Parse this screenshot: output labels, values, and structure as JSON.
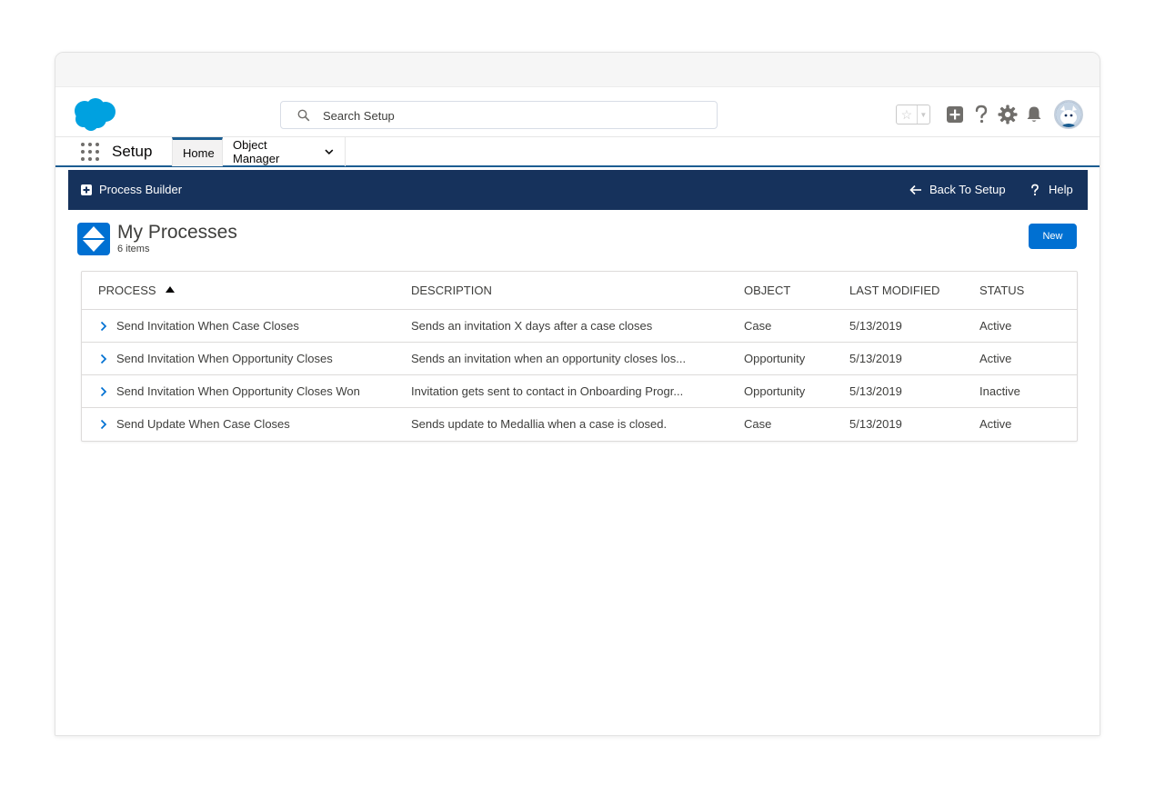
{
  "header": {
    "search_placeholder": "Search Setup"
  },
  "nav": {
    "app_name": "Setup",
    "tabs": [
      {
        "label": "Home",
        "active": true
      },
      {
        "label": "Object Manager",
        "active": false
      }
    ]
  },
  "process_builder_bar": {
    "title": "Process Builder",
    "back_label": "Back To Setup",
    "help_label": "Help",
    "background": "#16325c"
  },
  "page": {
    "title": "My Processes",
    "count": "6 items",
    "new_button": "New",
    "accent": "#0070d2"
  },
  "table": {
    "columns": [
      "PROCESS",
      "DESCRIPTION",
      "OBJECT",
      "LAST MODIFIED",
      "STATUS"
    ],
    "sort_column": "PROCESS",
    "sort_direction": "ascending",
    "rows": [
      {
        "process": "Send Invitation When Case Closes",
        "description": "Sends an invitation X days after a case closes",
        "object": "Case",
        "last_modified": "5/13/2019",
        "status": "Active"
      },
      {
        "process": "Send Invitation When Opportunity Closes",
        "description": "Sends an invitation when an opportunity closes los...",
        "object": "Opportunity",
        "last_modified": "5/13/2019",
        "status": "Active"
      },
      {
        "process": "Send Invitation When Opportunity Closes Won",
        "description": "Invitation gets sent to contact in Onboarding Progr...",
        "object": "Opportunity",
        "last_modified": "5/13/2019",
        "status": "Inactive"
      },
      {
        "process": "Send Update When Case Closes",
        "description": "Sends update to Medallia when a case is closed.",
        "object": "Case",
        "last_modified": "5/13/2019",
        "status": "Active"
      }
    ]
  },
  "icons": {
    "logo": "salesforce-cloud-logo",
    "search": "search-icon",
    "favorites": "star-icon",
    "global_actions": "add-icon",
    "help": "question-icon",
    "setup": "gear-icon",
    "notifications": "bell-icon",
    "app_launcher": "waffle-icon"
  }
}
